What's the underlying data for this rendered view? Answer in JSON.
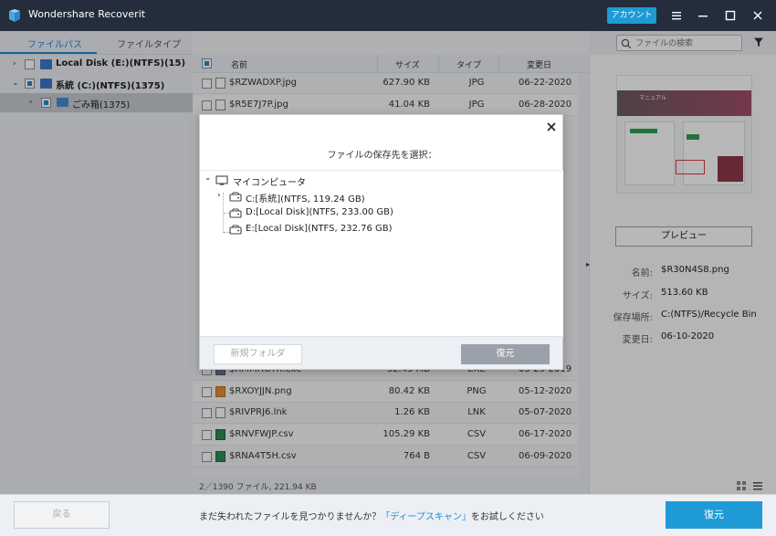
{
  "app": {
    "title": "Wondershare Recoverit",
    "account_label": "アカウント"
  },
  "left_pane": {
    "tabs": [
      {
        "label": "ファイルパス",
        "active": true
      },
      {
        "label": "ファイルタイプ",
        "active": false
      }
    ],
    "tree": [
      {
        "label": "Local Disk (E:)(NTFS)(15)",
        "expanded": false
      },
      {
        "label": "系統 (C:)(NTFS)(1375)",
        "expanded": true
      },
      {
        "label": "ごみ箱(1375)",
        "selected": true
      }
    ]
  },
  "search": {
    "placeholder": "ファイルの検索"
  },
  "file_list": {
    "columns": {
      "name": "名前",
      "size": "サイズ",
      "type": "タイプ",
      "date": "変更日"
    },
    "rows": [
      {
        "name": "$RZWADXP.jpg",
        "size": "627.90  KB",
        "type": "JPG",
        "date": "06-22-2020",
        "icon": "image-file-icon"
      },
      {
        "name": "$R5E7J7P.jpg",
        "size": "41.04  KB",
        "type": "JPG",
        "date": "06-28-2020",
        "icon": "image-file-icon"
      },
      {
        "name": "$RMMHOYX.exe",
        "size": "52.43  MB",
        "type": "EXE",
        "date": "03-29-2019",
        "icon": "exe-file-icon"
      },
      {
        "name": "$RXOYJJN.png",
        "size": "80.42  KB",
        "type": "PNG",
        "date": "05-12-2020",
        "icon": "png-file-icon"
      },
      {
        "name": "$RIVPRJ6.lnk",
        "size": "1.26  KB",
        "type": "LNK",
        "date": "05-07-2020",
        "icon": "lnk-file-icon"
      },
      {
        "name": "$RNVFWJP.csv",
        "size": "105.29  KB",
        "type": "CSV",
        "date": "06-17-2020",
        "icon": "excel-file-icon"
      },
      {
        "name": "$RNA4T5H.csv",
        "size": "764  B",
        "type": "CSV",
        "date": "06-09-2020",
        "icon": "excel-file-icon"
      }
    ],
    "footer": "2／1390 ファイル, 221.94  KB"
  },
  "preview": {
    "button_label": "プレビュー",
    "meta": [
      {
        "label": "名前:",
        "value": "$R30N4S8.png"
      },
      {
        "label": "サイズ:",
        "value": "513.60  KB"
      },
      {
        "label": "保存場所:",
        "value": "C:(NTFS)/Recycle Bin"
      },
      {
        "label": "変更日:",
        "value": "06-10-2020"
      }
    ],
    "thumb_text": "マニュアル"
  },
  "bottom": {
    "back_label": "戻る",
    "prompt_before": "まだ失われたファイルを見つかりませんか？",
    "prompt_link": "「ディープスキャン」",
    "prompt_after": "をお試しください",
    "recover_label": "復元"
  },
  "dialog": {
    "title": "ファイルの保存先を選択：",
    "root": "マイコンピュータ",
    "drives": [
      {
        "label": "C:[系統](NTFS, 119.24  GB)",
        "expandable": true
      },
      {
        "label": "D:[Local Disk](NTFS, 233.00  GB)",
        "expandable": false
      },
      {
        "label": "E:[Local Disk](NTFS, 232.76  GB)",
        "expandable": false
      }
    ],
    "new_folder_label": "新規フォルダ",
    "recover_label": "復元"
  },
  "colors": {
    "titlebar": "#242d3b",
    "accent": "#1e9ad6",
    "disabled_button": "#9aa1ab"
  }
}
